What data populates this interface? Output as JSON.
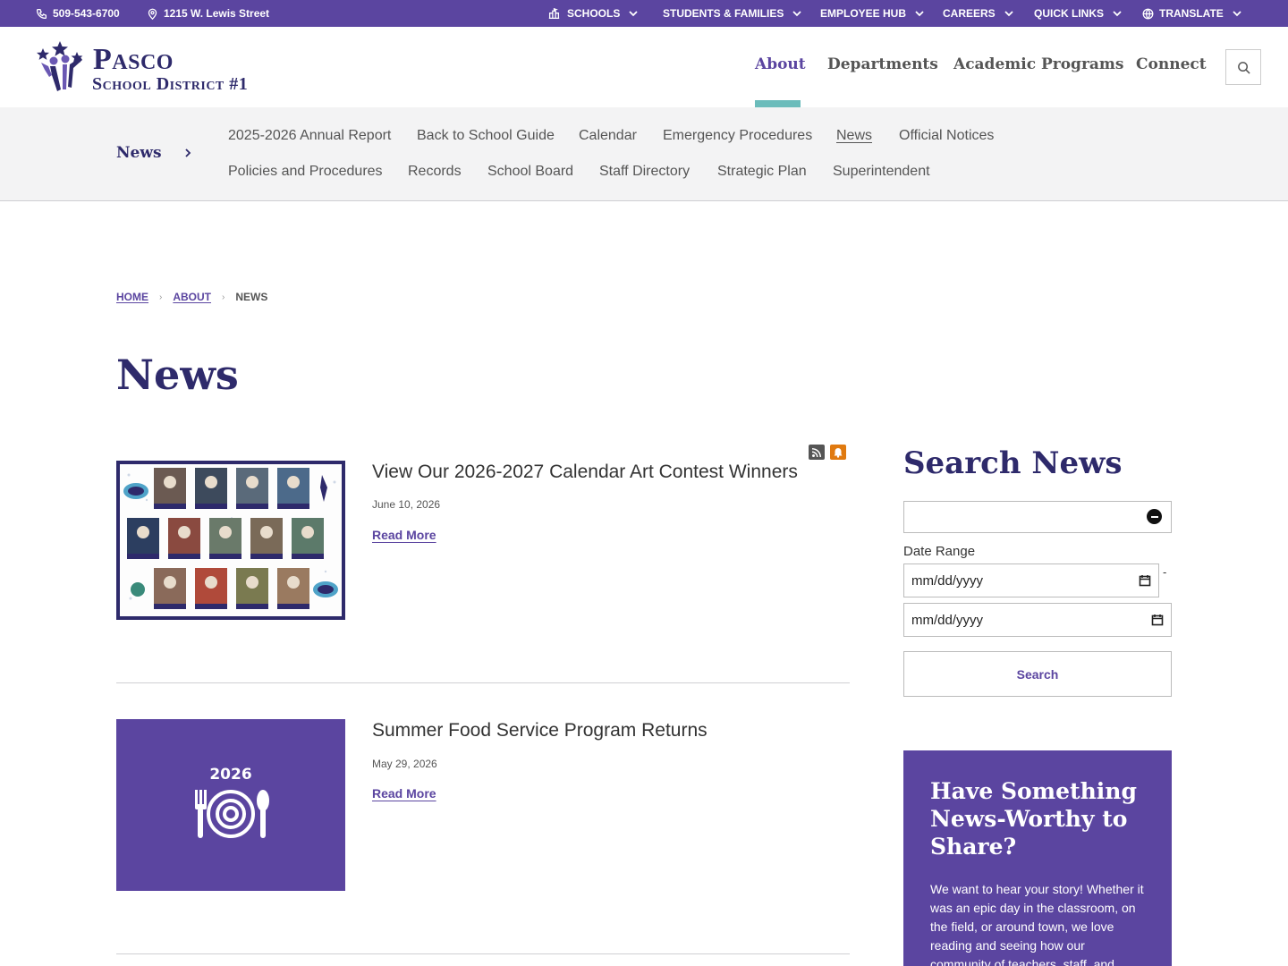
{
  "utility": {
    "phone": "509-543-6700",
    "address": "1215 W. Lewis Street",
    "menus": [
      "SCHOOLS",
      "STUDENTS & FAMILIES",
      "EMPLOYEE HUB",
      "CAREERS",
      "QUICK LINKS",
      "TRANSLATE"
    ]
  },
  "logo": {
    "line1": "Pasco",
    "line2": "School District #1"
  },
  "main_nav": [
    {
      "label": "About",
      "active": true
    },
    {
      "label": "Departments"
    },
    {
      "label": "Academic Programs"
    },
    {
      "label": "Connect"
    }
  ],
  "subnav": {
    "section": "News",
    "row1": [
      "2025-2026 Annual Report",
      "Back to School Guide",
      "Calendar",
      "Emergency Procedures",
      "News",
      "Official Notices"
    ],
    "row2": [
      "Policies and Procedures",
      "Records",
      "School Board",
      "Staff Directory",
      "Strategic Plan",
      "Superintendent"
    ],
    "current": "News"
  },
  "breadcrumb": {
    "home": "HOME",
    "about": "ABOUT",
    "current": "NEWS"
  },
  "page_title": "News",
  "articles": [
    {
      "title": "View Our 2026-2027 Calendar Art Contest Winners",
      "date": "June 10, 2026",
      "read_more": "Read More"
    },
    {
      "title": "Summer Food Service Program Returns",
      "date": "May 29, 2026",
      "read_more": "Read More",
      "image_text": "2026"
    }
  ],
  "sidebar": {
    "title": "Search News",
    "keyword_value": "",
    "date_range_label": "Date Range",
    "date_placeholder": "mm/dd/yyyy",
    "range_separator": "-",
    "search_label": "Search",
    "promo_title": "Have Something News-Worthy to Share?",
    "promo_text": "We want to hear your story! Whether it was an epic day in the classroom, on the field, or around town, we love reading and seeing how our community of teachers, staff, and"
  },
  "colors": {
    "brand_purple": "#5b45a0",
    "navy": "#2e2a6b",
    "teal": "#6bbcbb",
    "alert_orange": "#e07a10"
  }
}
